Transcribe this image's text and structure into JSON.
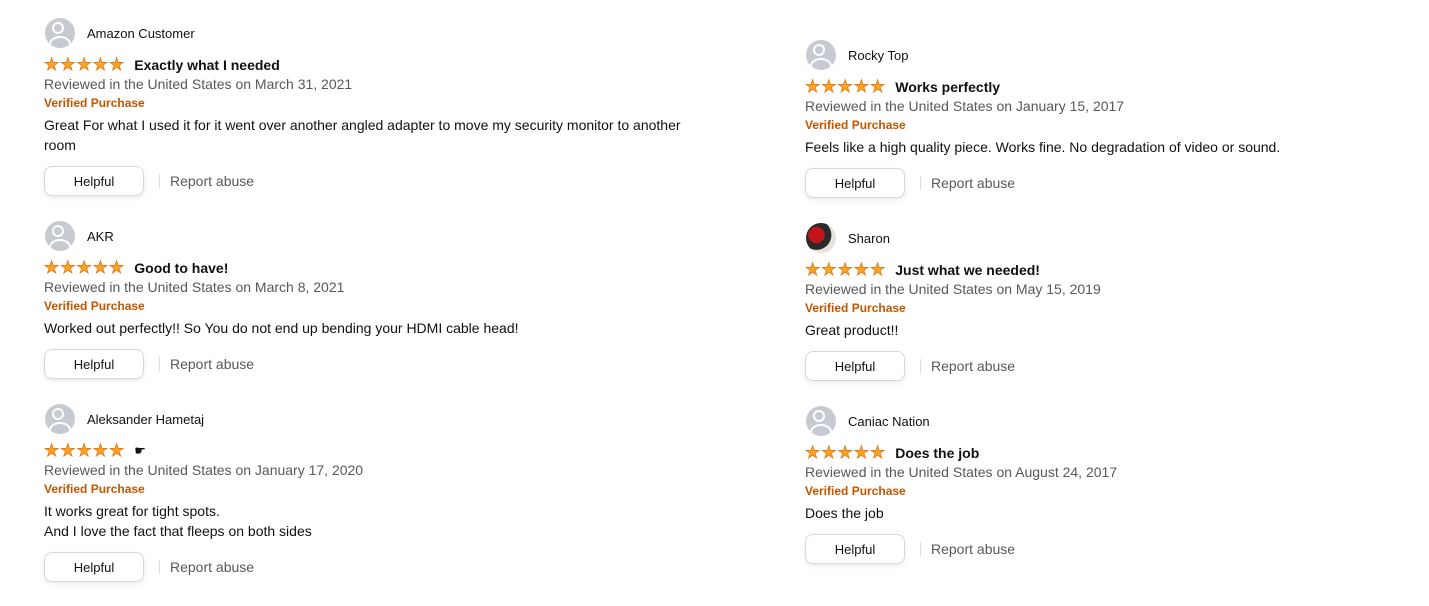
{
  "colors": {
    "star": "#ffa41c",
    "verified": "#c45500",
    "secondary_text": "#565959"
  },
  "common": {
    "verified_label": "Verified Purchase",
    "helpful_label": "Helpful",
    "report_label": "Report abuse"
  },
  "reviews": [
    {
      "name": "Amazon Customer",
      "avatar": "default-avatar-icon",
      "rating": 5,
      "title": "Exactly what I needed",
      "date": "Reviewed in the United States on March 31, 2021",
      "body": [
        "Great For what I used it for it went over another angled adapter to move my security monitor to another",
        "room"
      ]
    },
    {
      "name": "AKR",
      "avatar": "default-avatar-icon",
      "rating": 5,
      "title": "Good to have!",
      "date": "Reviewed in the United States on March 8, 2021",
      "body": [
        "Worked out perfectly!! So You do not end up bending your HDMI cable head!"
      ]
    },
    {
      "name": "Aleksander Hametaj",
      "avatar": "default-avatar-icon",
      "rating": 5,
      "title": "",
      "date": "Reviewed in the United States on January 17, 2020",
      "body": [
        "It works great for tight spots.",
        "And I love the fact that fleeps on both sides"
      ]
    },
    {
      "name": "Rocky Top",
      "avatar": "default-avatar-icon",
      "rating": 5,
      "title": "Works perfectly",
      "date": "Reviewed in the United States on January 15, 2017",
      "body": [
        "Feels like a high quality piece. Works fine. No degradation of video or sound."
      ]
    },
    {
      "name": "Sharon",
      "avatar": "photo-avatar",
      "rating": 5,
      "title": "Just what we needed!",
      "date": "Reviewed in the United States on May 15, 2019",
      "body": [
        "Great product!!"
      ]
    },
    {
      "name": "Caniac Nation",
      "avatar": "default-avatar-icon",
      "rating": 5,
      "title": "Does the job",
      "date": "Reviewed in the United States on August 24, 2017",
      "body": [
        "Does the job"
      ]
    }
  ]
}
